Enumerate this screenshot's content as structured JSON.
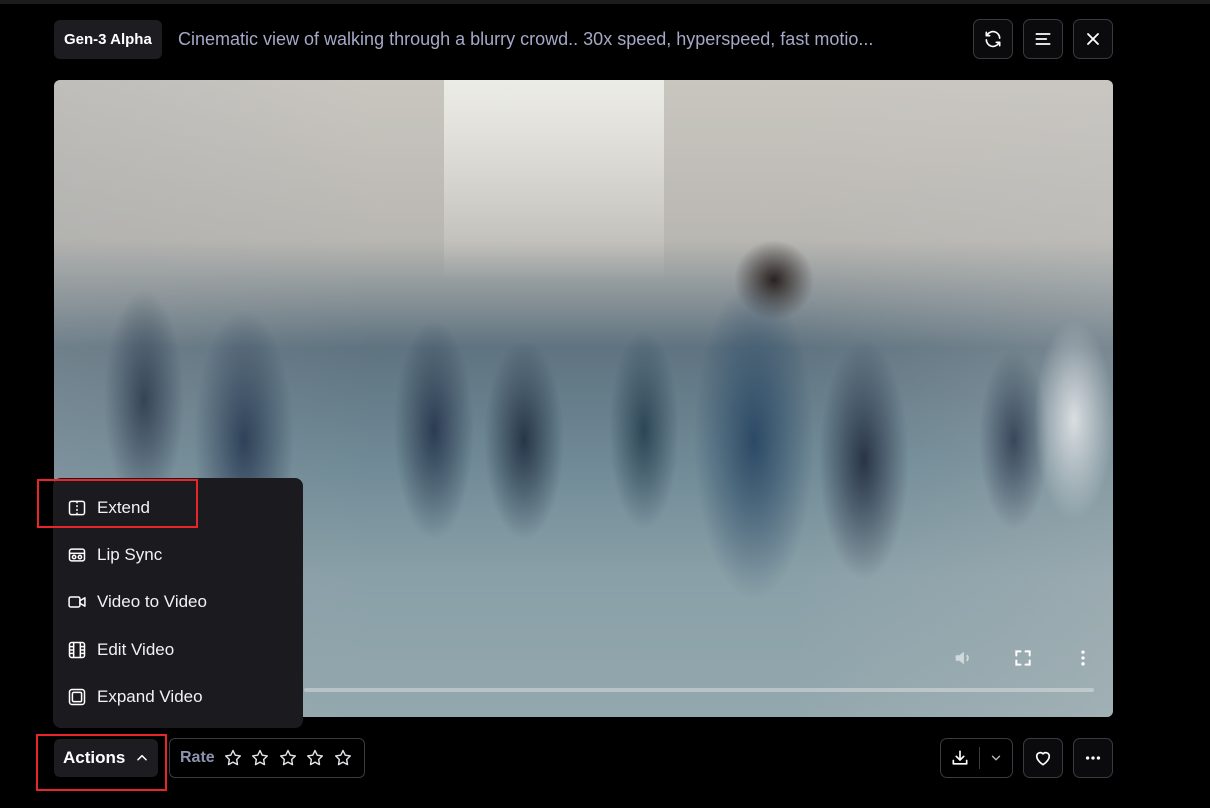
{
  "header": {
    "model_badge": "Gen-3 Alpha",
    "prompt": "Cinematic view of walking through a blurry crowd.. 30x speed, hyperspeed, fast motio..."
  },
  "video": {
    "icons": [
      "volume-icon",
      "fullscreen-icon",
      "more-vertical-icon"
    ]
  },
  "actions_menu": {
    "items": [
      {
        "label": "Extend",
        "icon": "extend-icon"
      },
      {
        "label": "Lip Sync",
        "icon": "lip-sync-icon"
      },
      {
        "label": "Video to Video",
        "icon": "video-camera-icon"
      },
      {
        "label": "Edit Video",
        "icon": "film-strip-icon"
      },
      {
        "label": "Expand Video",
        "icon": "expand-frame-icon"
      }
    ]
  },
  "footer": {
    "actions_label": "Actions",
    "rate_label": "Rate",
    "rating_stars_total": 5,
    "rating_value": 0
  },
  "colors": {
    "background": "#000000",
    "panel": "#1b1b1f",
    "highlight": "#e8262a",
    "prompt_text": "#a5a8c6"
  }
}
